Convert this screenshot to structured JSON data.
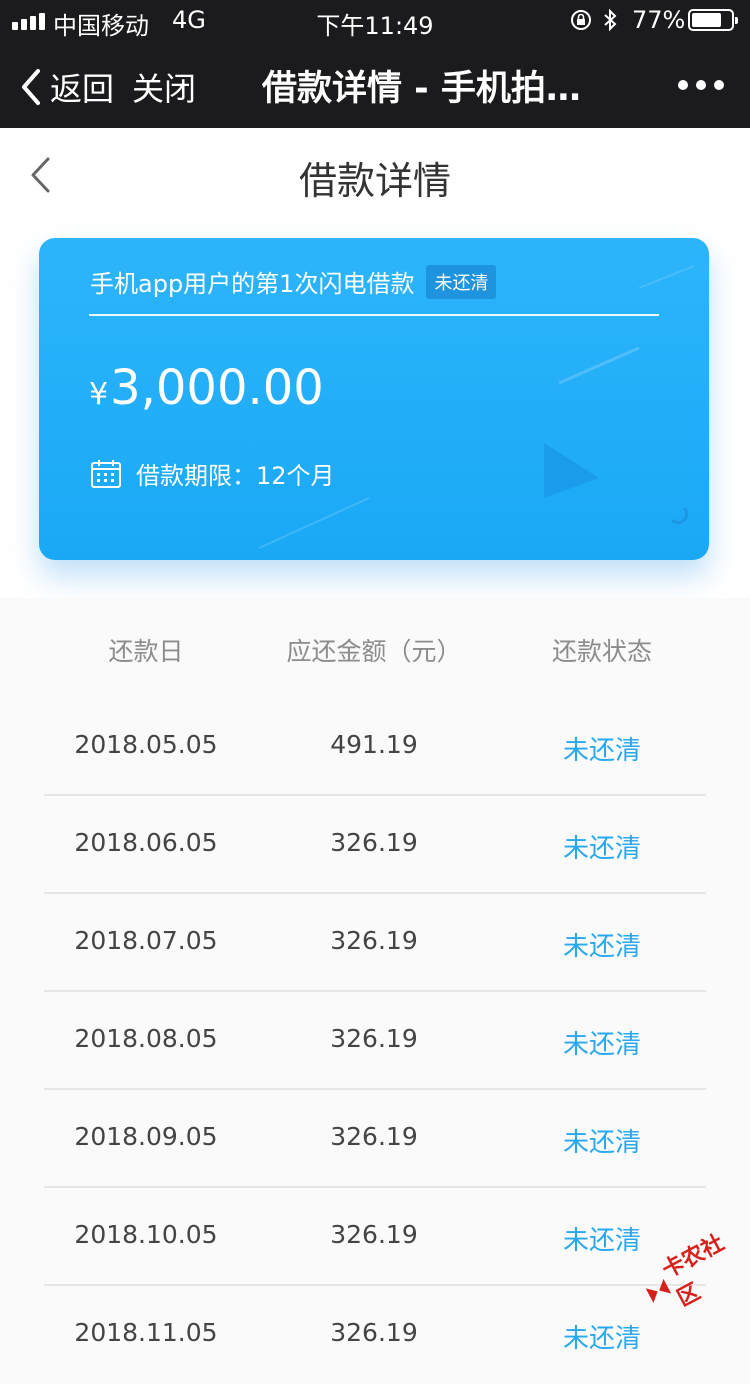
{
  "status_bar": {
    "carrier": "中国移动",
    "network": "4G",
    "time": "下午11:49",
    "battery_percent": "77%",
    "battery_level": 0.77
  },
  "wechat_nav": {
    "back_label": "返回",
    "close_label": "关闭",
    "title": "借款详情 - 手机拍…"
  },
  "page": {
    "title": "借款详情"
  },
  "loan_card": {
    "title": "手机app用户的第1次闪电借款",
    "badge": "未还清",
    "currency": "¥",
    "amount": "3,000.00",
    "term_label": "借款期限：12个月"
  },
  "table": {
    "headers": [
      "还款日",
      "应还金额（元）",
      "还款状态"
    ],
    "rows": [
      {
        "date": "2018.05.05",
        "amount": "491.19",
        "status": "未还清"
      },
      {
        "date": "2018.06.05",
        "amount": "326.19",
        "status": "未还清"
      },
      {
        "date": "2018.07.05",
        "amount": "326.19",
        "status": "未还清"
      },
      {
        "date": "2018.08.05",
        "amount": "326.19",
        "status": "未还清"
      },
      {
        "date": "2018.09.05",
        "amount": "326.19",
        "status": "未还清"
      },
      {
        "date": "2018.10.05",
        "amount": "326.19",
        "status": "未还清"
      },
      {
        "date": "2018.11.05",
        "amount": "326.19",
        "status": "未还清"
      }
    ]
  },
  "watermark": {
    "text": "卡农社区"
  },
  "colors": {
    "card_blue": "#1aa8f5",
    "status_blue": "#28a8ef",
    "watermark_red": "#d7201c"
  }
}
